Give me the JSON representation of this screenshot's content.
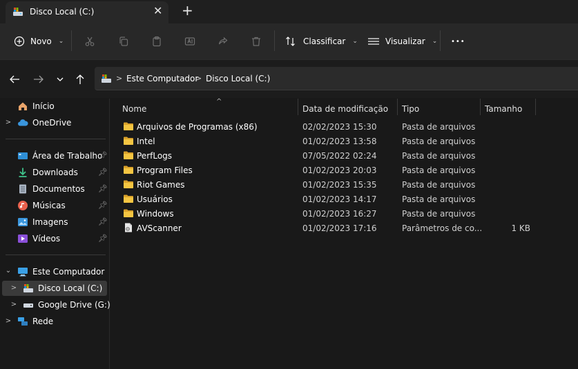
{
  "tab": {
    "title": "Disco Local (C:)",
    "close_glyph": "✕",
    "new_tab_glyph": "+"
  },
  "toolbar": {
    "new_label": "Novo",
    "sort_label": "Classificar",
    "view_label": "Visualizar",
    "more_glyph": "•••"
  },
  "address": {
    "crumbs": [
      "Este Computador",
      "Disco Local (C:)"
    ]
  },
  "sidebar": {
    "items": [
      {
        "label": "Início",
        "icon": "home-icon"
      },
      {
        "label": "OneDrive",
        "icon": "cloud-icon"
      },
      {
        "label": "Área de Trabalho",
        "icon": "desktop-icon",
        "pinned": true
      },
      {
        "label": "Downloads",
        "icon": "download-icon",
        "pinned": true
      },
      {
        "label": "Documentos",
        "icon": "document-icon",
        "pinned": true
      },
      {
        "label": "Músicas",
        "icon": "music-icon",
        "pinned": true
      },
      {
        "label": "Imagens",
        "icon": "image-icon",
        "pinned": true
      },
      {
        "label": "Vídeos",
        "icon": "video-icon",
        "pinned": true
      },
      {
        "label": "Este Computador",
        "icon": "computer-icon"
      },
      {
        "label": "Disco Local (C:)",
        "icon": "drive-icon",
        "selected": true
      },
      {
        "label": "Google Drive (G:)",
        "icon": "drive-icon"
      },
      {
        "label": "Rede",
        "icon": "network-icon"
      }
    ]
  },
  "columns": {
    "name": "Nome",
    "date": "Data de modificação",
    "type": "Tipo",
    "size": "Tamanho"
  },
  "files": [
    {
      "name": "Arquivos de Programas (x86)",
      "date": "02/02/2023 15:30",
      "type": "Pasta de arquivos",
      "size": ""
    },
    {
      "name": "Intel",
      "date": "01/02/2023 13:58",
      "type": "Pasta de arquivos",
      "size": ""
    },
    {
      "name": "PerfLogs",
      "date": "07/05/2022 02:24",
      "type": "Pasta de arquivos",
      "size": ""
    },
    {
      "name": "Program Files",
      "date": "01/02/2023 20:03",
      "type": "Pasta de arquivos",
      "size": ""
    },
    {
      "name": "Riot Games",
      "date": "01/02/2023 15:35",
      "type": "Pasta de arquivos",
      "size": ""
    },
    {
      "name": "Usuários",
      "date": "01/02/2023 14:17",
      "type": "Pasta de arquivos",
      "size": ""
    },
    {
      "name": "Windows",
      "date": "01/02/2023 16:27",
      "type": "Pasta de arquivos",
      "size": ""
    },
    {
      "name": "AVScanner",
      "date": "01/02/2023 17:16",
      "type": "Parâmetros de co...",
      "size": "1 KB"
    }
  ],
  "colors": {
    "folder": "#f4c542",
    "accent": "#4cc2ff",
    "background": "#191919"
  }
}
